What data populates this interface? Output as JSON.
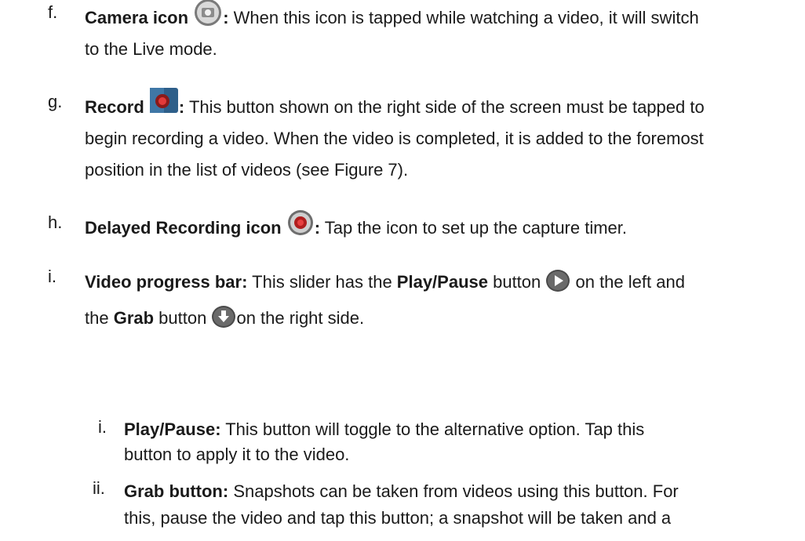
{
  "items": {
    "f": {
      "marker": "f.",
      "title": "Camera icon",
      "colon": ":",
      "text1": " When this icon is tapped while watching a video, it will switch",
      "text2": "to the Live mode."
    },
    "g": {
      "marker": "g.",
      "title": "Record",
      "colon": ":",
      "text1": " This button shown on the right side of the screen must be tapped to",
      "text2": "begin recording a video. When the video is completed, it is added to the foremost",
      "text3": "position in the list of videos (see Figure 7)."
    },
    "h": {
      "marker": "h.",
      "title": "Delayed Recording icon",
      "colon": ":",
      "text1": " Tap the icon to set up the capture timer."
    },
    "i": {
      "marker": "i.",
      "title": "Video progress bar:",
      "text1a": " This slider has the ",
      "text1b": "Play/Pause",
      "text1c": " button ",
      "text1d": " on the left and",
      "text2a": "the ",
      "text2b": "Grab",
      "text2c": " button ",
      "text2d": "on the right side."
    },
    "i_i": {
      "marker": "i.",
      "title": "Play/Pause:",
      "text1": " This button will toggle to the alternative option. Tap this",
      "text2": "button to apply it to the video."
    },
    "i_ii": {
      "marker": "ii.",
      "title": "Grab button:",
      "text1": " Snapshots can be taken from videos using this button. For",
      "text2": "this, pause the video and tap this button; a snapshot will be taken and a"
    }
  },
  "icons": {
    "camera": "camera-icon",
    "record": "record-icon",
    "timer": "timer-icon",
    "play": "play-icon",
    "grab": "download-icon"
  }
}
